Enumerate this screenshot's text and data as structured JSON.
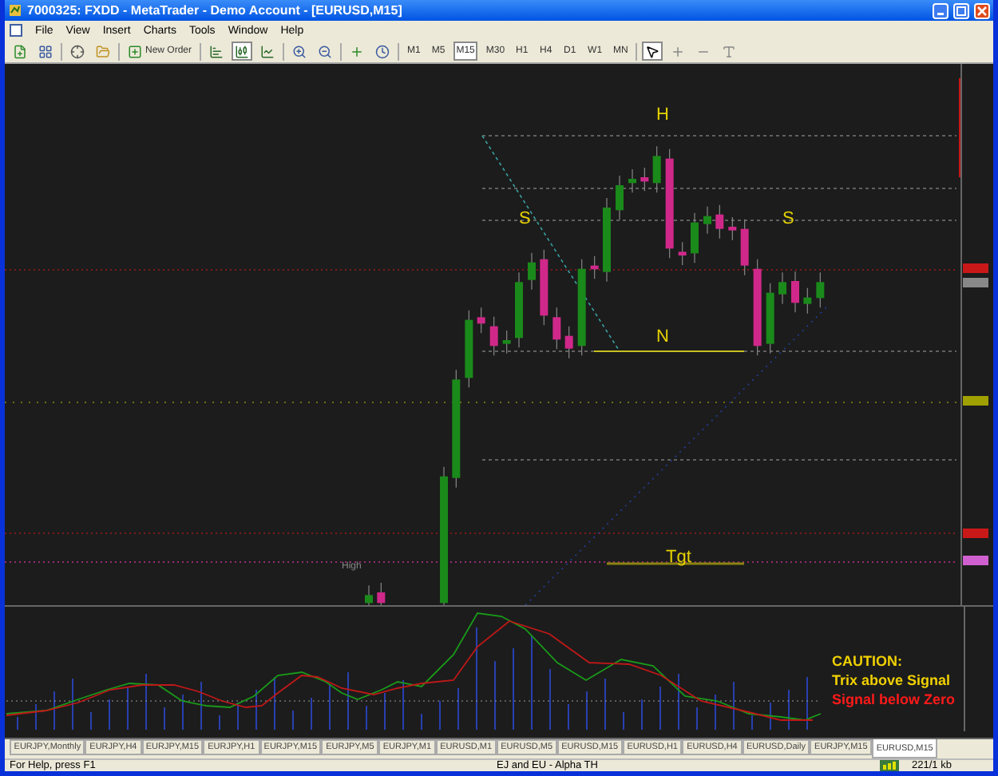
{
  "window": {
    "title": "7000325: FXDD - MetaTrader - Demo Account - [EURUSD,M15]"
  },
  "menu": [
    "File",
    "View",
    "Insert",
    "Charts",
    "Tools",
    "Window",
    "Help"
  ],
  "toolbar": {
    "new_order": "New Order",
    "timeframes": [
      {
        "label": "M1",
        "selected": false
      },
      {
        "label": "M5",
        "selected": false
      },
      {
        "label": "M15",
        "selected": true
      },
      {
        "label": "M30",
        "selected": false
      },
      {
        "label": "H1",
        "selected": false
      },
      {
        "label": "H4",
        "selected": false
      },
      {
        "label": "D1",
        "selected": false
      },
      {
        "label": "W1",
        "selected": false
      },
      {
        "label": "MN",
        "selected": false
      }
    ]
  },
  "chart": {
    "labels": [
      "H",
      "S",
      "S",
      "N",
      "Tgt"
    ],
    "high_label": "High"
  },
  "indicator": {
    "notes": [
      {
        "text": "CAUTION:",
        "color": "#f0d000"
      },
      {
        "text": "Trix above Signal",
        "color": "#f0d000"
      },
      {
        "text": "Signal below Zero",
        "color": "#ff1a1a"
      }
    ]
  },
  "tabs": [
    {
      "label": "EURJPY,Monthly",
      "selected": false
    },
    {
      "label": "EURJPY,H4",
      "selected": false
    },
    {
      "label": "EURJPY,M15",
      "selected": false
    },
    {
      "label": "EURJPY,H1",
      "selected": false
    },
    {
      "label": "EURJPY,M15",
      "selected": false
    },
    {
      "label": "EURJPY,M5",
      "selected": false
    },
    {
      "label": "EURJPY,M1",
      "selected": false
    },
    {
      "label": "EURUSD,M1",
      "selected": false
    },
    {
      "label": "EURUSD,M5",
      "selected": false
    },
    {
      "label": "EURUSD,M15",
      "selected": false
    },
    {
      "label": "EURUSD,H1",
      "selected": false
    },
    {
      "label": "EURUSD,H4",
      "selected": false
    },
    {
      "label": "EURUSD,Daily",
      "selected": false
    },
    {
      "label": "EURJPY,M15",
      "selected": false
    },
    {
      "label": "EURUSD,M15",
      "selected": true
    }
  ],
  "status_bar": {
    "help": "For Help, press F1",
    "profile": "EJ and EU - Alpha TH",
    "traffic": "221/1 kb"
  }
}
